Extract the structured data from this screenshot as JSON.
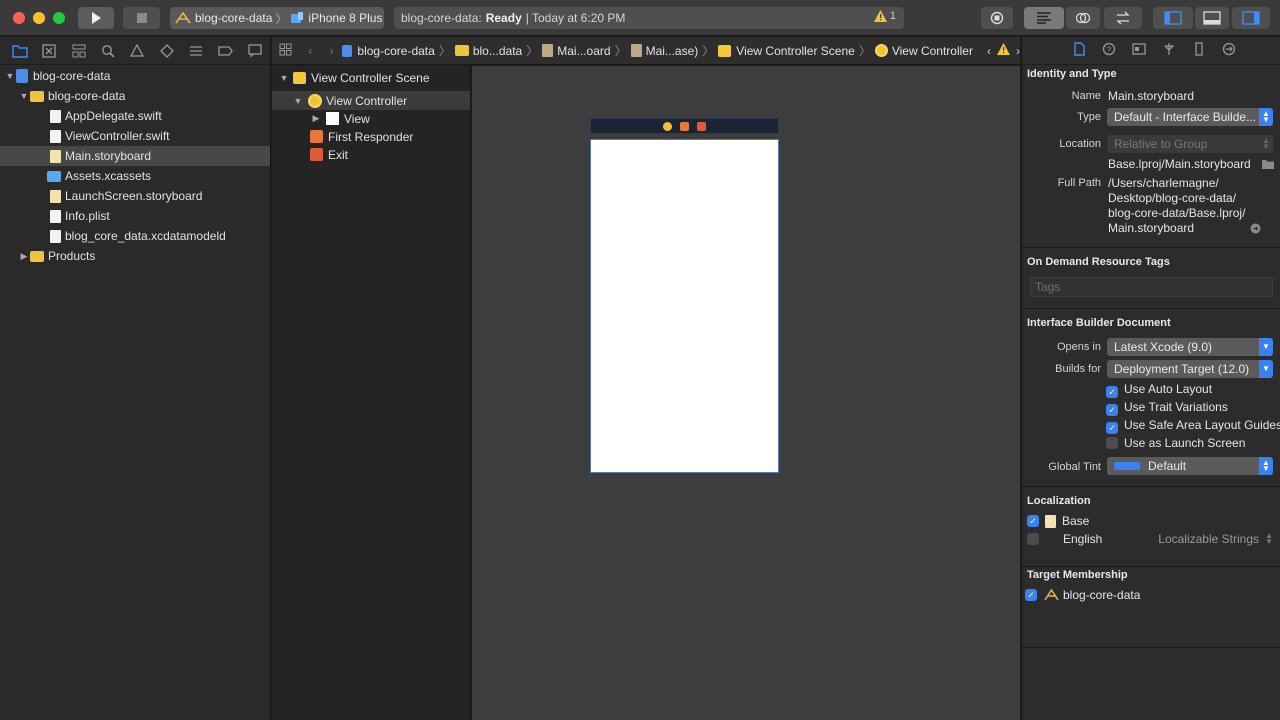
{
  "toolbar": {
    "scheme_target": "blog-core-data",
    "scheme_device": "iPhone 8 Plus",
    "activity_project": "blog-core-data:",
    "activity_status": "Ready",
    "activity_time": "| Today at 6:20 PM",
    "warning_count": "1",
    "colors": {
      "close": "#fe5f57",
      "minimize": "#febc2e",
      "zoom": "#28c840",
      "accent": "#3a82f0"
    }
  },
  "navigator": {
    "items": [
      {
        "label": "blog-core-data",
        "icon": "project-icon"
      },
      {
        "label": "blog-core-data",
        "icon": "folder-icon"
      },
      {
        "label": "AppDelegate.swift",
        "icon": "swift-file-icon"
      },
      {
        "label": "ViewController.swift",
        "icon": "swift-file-icon"
      },
      {
        "label": "Main.storyboard",
        "icon": "storyboard-file-icon"
      },
      {
        "label": "Assets.xcassets",
        "icon": "asset-folder-icon"
      },
      {
        "label": "LaunchScreen.storyboard",
        "icon": "storyboard-file-icon"
      },
      {
        "label": "Info.plist",
        "icon": "plist-file-icon"
      },
      {
        "label": "blog_core_data.xcdatamodeld",
        "icon": "datamodel-file-icon"
      },
      {
        "label": "Products",
        "icon": "folder-icon"
      }
    ]
  },
  "jumpbar": {
    "crumbs": [
      "blog-core-data",
      "blo...data",
      "Mai...oard",
      "Mai...ase)",
      "View Controller Scene",
      "View Controller"
    ]
  },
  "outline": {
    "items": [
      "View Controller Scene",
      "View Controller",
      "View",
      "First Responder",
      "Exit"
    ]
  },
  "inspector": {
    "identity": {
      "heading": "Identity and Type",
      "name_label": "Name",
      "name_value": "Main.storyboard",
      "type_label": "Type",
      "type_value": "Default - Interface Builde...",
      "location_label": "Location",
      "location_value": "Relative to Group",
      "relative_path": "Base.lproj/Main.storyboard",
      "full_path_label": "Full Path",
      "full_path_lines": [
        "/Users/charlemagne/",
        "Desktop/blog-core-data/",
        "blog-core-data/Base.lproj/",
        "Main.storyboard"
      ]
    },
    "odr": {
      "heading": "On Demand Resource Tags",
      "tags_placeholder": "Tags"
    },
    "ib_document": {
      "heading": "Interface Builder Document",
      "opens_in_label": "Opens in",
      "opens_in_value": "Latest Xcode (9.0)",
      "builds_for_label": "Builds for",
      "builds_for_value": "Deployment Target (12.0)",
      "checkboxes": [
        {
          "label": "Use Auto Layout",
          "checked": true
        },
        {
          "label": "Use Trait Variations",
          "checked": true
        },
        {
          "label": "Use Safe Area Layout Guides",
          "checked": true
        },
        {
          "label": "Use as Launch Screen",
          "checked": false
        }
      ],
      "global_tint_label": "Global Tint",
      "global_tint_value": "Default"
    },
    "localization": {
      "heading": "Localization",
      "base_label": "Base",
      "english_label": "English",
      "english_value": "Localizable Strings"
    },
    "target_membership": {
      "heading": "Target Membership",
      "target_label": "blog-core-data"
    }
  }
}
